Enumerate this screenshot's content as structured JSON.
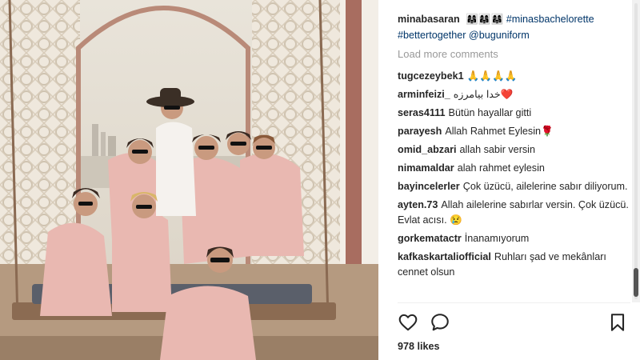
{
  "post": {
    "author": "minabasaran",
    "author_emoji": "👩‍👩‍👧👩‍👩‍👧👩‍👩‍👧",
    "caption_hashtag": "#minasbachelorette",
    "caption_hashtag2": "#bettertogether",
    "caption_mention": "@buguniform",
    "load_more": "Load more comments",
    "likes": "978 likes"
  },
  "comments": [
    {
      "user": "tugcezeybek1",
      "text": "🙏🙏🙏🙏"
    },
    {
      "user": "arminfeizi_",
      "text": "خدا بیامرزه❤️"
    },
    {
      "user": "seras4111",
      "text": "Bütün hayallar gitti"
    },
    {
      "user": "parayesh",
      "text": "Allah Rahmet Eylesin🌹"
    },
    {
      "user": "omid_abzari",
      "text": "allah sabir versin"
    },
    {
      "user": "nimamaldar",
      "text": "alah rahmet eylesin"
    },
    {
      "user": "bayincelerler",
      "text": "Çok üzücü, ailelerine sabır diliyorum."
    },
    {
      "user": "ayten.73",
      "text": "Allah ailelerine sabırlar versin. Çok üzücü. Evlat acısı. 😢"
    },
    {
      "user": "gorkematactr",
      "text": "İnanamıyorum"
    },
    {
      "user": "kafkaskartaliofficial",
      "text": "Ruhları şad ve mekânları cennet olsun"
    }
  ],
  "icons": {
    "like": "heart-icon",
    "comment": "comment-bubble-icon",
    "save": "bookmark-icon"
  },
  "colors": {
    "text": "#262626",
    "muted": "#999999",
    "link": "#003569",
    "robe": "#e9b8b1"
  }
}
